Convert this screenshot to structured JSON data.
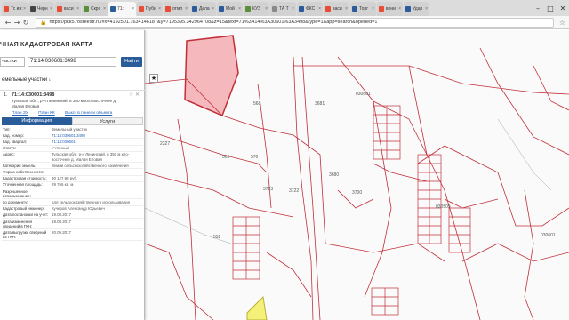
{
  "browser": {
    "tabs": [
      {
        "label": "Тс ин:",
        "color": "#e94b35"
      },
      {
        "label": "Черн",
        "color": "#444444"
      },
      {
        "label": "васи",
        "color": "#e94b35"
      },
      {
        "label": "Скро",
        "color": "#5a8f3a"
      },
      {
        "label": "71:",
        "color": "#2b5c9a",
        "active": true
      },
      {
        "label": "Пуби",
        "color": "#e94b35"
      },
      {
        "label": "отмп",
        "color": "#e94b35"
      },
      {
        "label": "Дела",
        "color": "#2b5c9a"
      },
      {
        "label": "Мой",
        "color": "#2b5c9a"
      },
      {
        "label": "КУЗ",
        "color": "#5a8f3a"
      },
      {
        "label": "ТА Т",
        "color": "#888888"
      },
      {
        "label": "ФКС",
        "color": "#2b5c9a"
      },
      {
        "label": "васи",
        "color": "#e94b35"
      },
      {
        "label": "Торг",
        "color": "#2b5c9a"
      },
      {
        "label": "вони",
        "color": "#e94b35"
      },
      {
        "label": "Удар",
        "color": "#2b5c9a"
      }
    ],
    "url": "https://pkk5.rosreestr.ru/#x=4192501.1634146187&y=7195395.342964708&z=15&text=71%3A14%3A30601%3A3498&type=1&app=search&opened=1",
    "secure_label": "🔒"
  },
  "panel": {
    "title": "ЧНАЯ КАДАСТРОВАЯ КАРТА",
    "select_value": "частки",
    "search_value": "71:14:030601:3498",
    "find_label": "Найти",
    "section_label": "емельные участки",
    "section_count": "1",
    "pin_icon": "★",
    "result": {
      "num": "1.",
      "id": "71:14:030601:3498",
      "address": "Тульская обл., р-н Ленинский, в 350 м юго-восточнее д. Малая Еловая",
      "link1": "План ЗУ",
      "link2": "План КК",
      "link3": "Выкл. в панели объекта",
      "tools": "☆ ✕"
    },
    "tabs": {
      "info": "Информация",
      "services": "Услуги"
    },
    "props": [
      {
        "k": "Тип:",
        "v": "Земельный участок",
        "link": false
      },
      {
        "k": "Кад. номер:",
        "v": "71:14:030601:3498",
        "link": true
      },
      {
        "k": "Кад. квартал:",
        "v": "71:14:030601",
        "link": true
      },
      {
        "k": "Статус:",
        "v": "Учтенный",
        "link": false
      },
      {
        "k": "Адрес:",
        "v": "Тульская обл., р-н Ленинский, в 350 м юго-восточнее д. Малая Еловая",
        "link": false
      },
      {
        "k": "Категория земель:",
        "v": "Земли сельскохозяйственного назначения",
        "link": false
      },
      {
        "k": "Форма собственности:",
        "v": "-",
        "link": false
      },
      {
        "k": "Кадастровая стоимость:",
        "v": "90 127,98 руб.",
        "link": false
      },
      {
        "k": "Уточненная площадь:",
        "v": "29 766 кв. м",
        "link": false
      },
      {
        "k": "Разрешенное использование:",
        "v": "-",
        "link": false
      },
      {
        "k": "по документу:",
        "v": "для сельскохозяйственного использования",
        "link": false
      },
      {
        "k": "Кадастровый инженер:",
        "v": "Кучеров Александр Юрьевич",
        "link": false
      },
      {
        "k": "Дата постановки на учет:",
        "v": "19.08.2017",
        "link": false
      },
      {
        "k": "Дата изменения сведений в ГКН:",
        "v": "19.08.2017",
        "link": false
      },
      {
        "k": "Дата выгрузки сведений из ГКН:",
        "v": "20.09.2017",
        "link": false
      }
    ]
  },
  "map": {
    "labels": [
      "030601",
      "030505",
      "030601",
      "3722",
      "3723",
      "2327",
      "030601",
      "14"
    ],
    "parcel_numbers": [
      "568",
      "3681",
      "570",
      "569",
      "552",
      "3680",
      "3700"
    ]
  }
}
